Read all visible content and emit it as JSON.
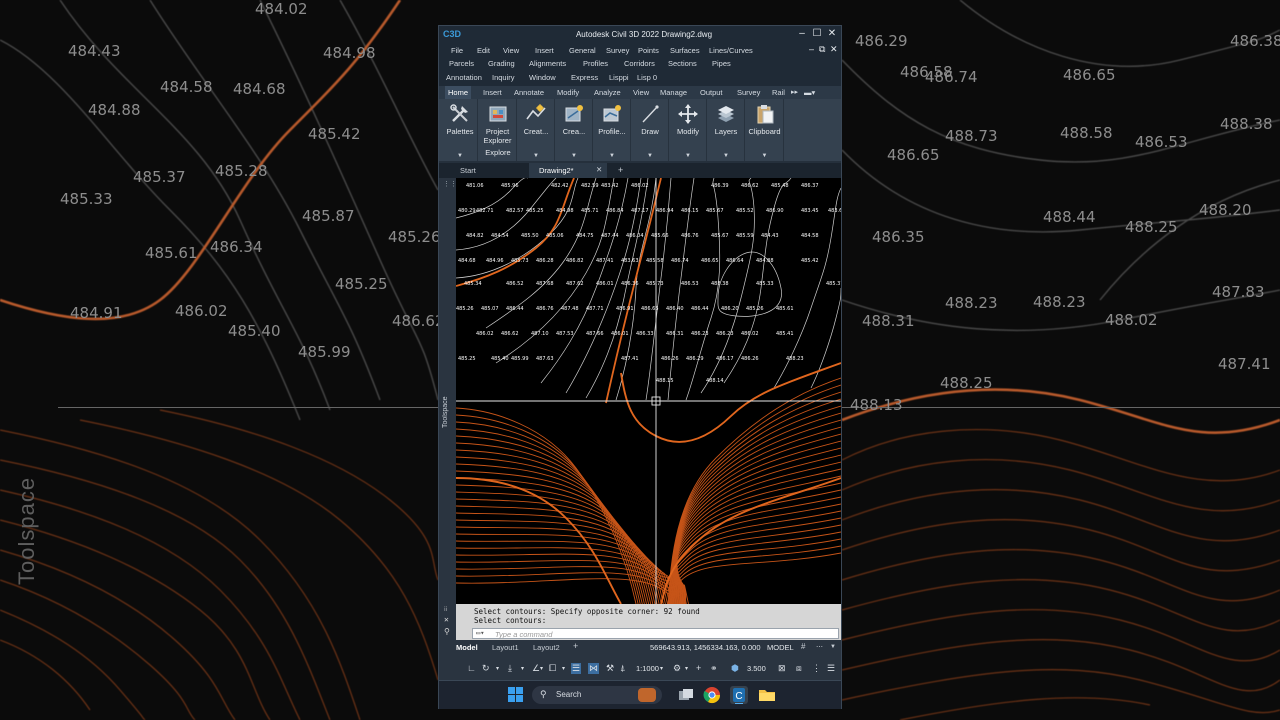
{
  "window": {
    "title": "Autodesk Civil 3D 2022   Drawing2.dwg",
    "logo": "C3D"
  },
  "menubar": {
    "row1": [
      "File",
      "Edit",
      "View",
      "Insert",
      "General",
      "Survey",
      "Points",
      "Surfaces",
      "Lines/Curves"
    ],
    "row2": [
      "Parcels",
      "Grading",
      "Alignments",
      "Profiles",
      "Corridors",
      "Sections",
      "Pipes"
    ],
    "row3": [
      "Annotation",
      "Inquiry",
      "Window",
      "Express",
      "Lisppi",
      "Lisp 0"
    ]
  },
  "ribbon_tabs": [
    "Home",
    "Insert",
    "Annotate",
    "Modify",
    "Analyze",
    "View",
    "Manage",
    "Output",
    "Survey",
    "Rail"
  ],
  "ribbon_panels": [
    {
      "label": "Palettes",
      "icon": "wrench-hammer-icon"
    },
    {
      "label": "Project Explorer",
      "icon": "project-explorer-icon"
    },
    {
      "label": "Creat...",
      "icon": "create-ground-data-icon"
    },
    {
      "label": "Crea...",
      "icon": "create-design-icon"
    },
    {
      "label": "Profile...",
      "icon": "profile-section-views-icon"
    },
    {
      "label": "Draw",
      "icon": "draw-line-icon"
    },
    {
      "label": "Modify",
      "icon": "move-arrows-icon"
    },
    {
      "label": "Layers",
      "icon": "layers-icon"
    },
    {
      "label": "Clipboard",
      "icon": "clipboard-icon"
    }
  ],
  "explore_label": "Explore",
  "doc_tabs": {
    "start": "Start",
    "active": "Drawing2*"
  },
  "toolspace_label": "Toolspace",
  "command": {
    "line1": "Select contours: Specify opposite corner: 92 found",
    "line2": "Select contours:",
    "placeholder": "Type a command"
  },
  "layout_tabs": [
    "Model",
    "Layout1",
    "Layout2"
  ],
  "coordinates": "569643.913, 1456334.163, 0.000",
  "space": "MODEL",
  "status": {
    "scale": "1:1000",
    "anno_scale": "3.500"
  },
  "taskbar": {
    "search": "Search"
  },
  "viewport_spot_labels": [
    "481.06",
    "485.96",
    "482.42",
    "482.59",
    "483.42",
    "486.02",
    "486.39",
    "486.62",
    "485.48",
    "486.37",
    "480.29",
    "482.71",
    "482.57",
    "485.25",
    "484.98",
    "485.71",
    "486.84",
    "487.17",
    "486.94",
    "486.15",
    "485.67",
    "485.52",
    "486.90",
    "483.45",
    "483.60",
    "484.82",
    "484.54",
    "485.50",
    "485.06",
    "484.75",
    "487.44",
    "486.04",
    "485.66",
    "486.76",
    "485.67",
    "485.59",
    "484.43",
    "484.58",
    "484.68",
    "484.96",
    "485.73",
    "486.28",
    "486.82",
    "487.41",
    "483.63",
    "485.58",
    "486.74",
    "486.65",
    "486.64",
    "484.88",
    "485.42",
    "485.34",
    "486.52",
    "487.68",
    "487.62",
    "486.01",
    "486.36",
    "485.73",
    "486.53",
    "488.38",
    "485.33",
    "485.37",
    "485.26",
    "485.07",
    "486.44",
    "486.76",
    "487.48",
    "487.71",
    "486.91",
    "486.65",
    "486.40",
    "486.44",
    "486.20",
    "485.26",
    "485.61",
    "486.02",
    "486.62",
    "487.10",
    "487.53",
    "487.66",
    "486.01",
    "486.33",
    "486.31",
    "486.23",
    "486.23",
    "486.02",
    "485.41",
    "485.25",
    "485.40",
    "485.99",
    "487.63",
    "487.41",
    "486.26",
    "486.29",
    "486.17",
    "486.26",
    "488.23",
    "488.15",
    "488.14"
  ],
  "backdrop_labels": [
    "484.43",
    "484.02",
    "484.98",
    "484.88",
    "484.58",
    "484.68",
    "485.42",
    "485.37",
    "485.33",
    "485.28",
    "485.87",
    "485.26",
    "485.61",
    "486.34",
    "485.25",
    "486.02",
    "485.40",
    "485.99",
    "486.62",
    "484.91",
    "486.29",
    "486.74",
    "486.65",
    "486.58",
    "486.38",
    "488.73",
    "488.58",
    "486.53",
    "486.65",
    "488.38",
    "486.35",
    "488.44",
    "488.25",
    "488.20",
    "488.23",
    "488.23",
    "487.83",
    "488.31",
    "488.02",
    "487.41",
    "488.25",
    "488.13"
  ]
}
